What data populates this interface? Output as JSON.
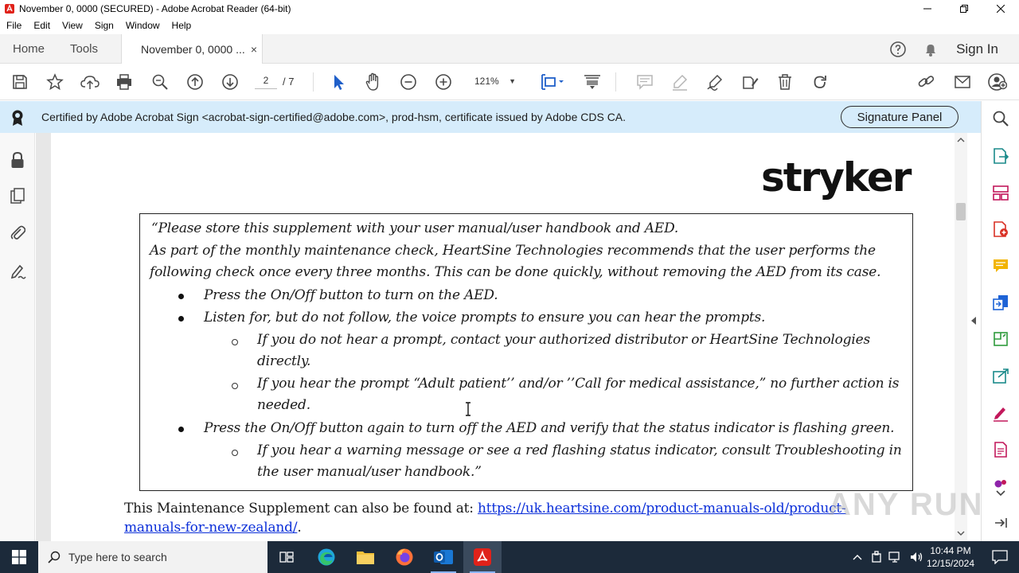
{
  "window": {
    "title": "November 0, 0000 (SECURED) - Adobe Acrobat Reader (64-bit)"
  },
  "menu": [
    "File",
    "Edit",
    "View",
    "Sign",
    "Window",
    "Help"
  ],
  "tabs": {
    "home": "Home",
    "tools": "Tools",
    "document": "November 0, 0000 ...",
    "close": "×",
    "signin": "Sign In"
  },
  "toolbar": {
    "page_current": "2",
    "page_total": "/ 7",
    "zoom": "121%"
  },
  "cert": {
    "text": "Certified by Adobe Acrobat Sign <acrobat-sign-certified@adobe.com>, prod-hsm, certificate issued by Adobe CDS CA.",
    "button": "Signature Panel"
  },
  "document": {
    "logo": "stryker",
    "note_lines": [
      "“Please store this supplement with your user manual/user handbook and AED.",
      "As part of the monthly maintenance check, HeartSine Technologies recommends that the user performs the",
      "following check once every three months. This can be done quickly, without removing the AED from its case."
    ],
    "bullets": [
      "Press the On/Off button to turn on the AED.",
      "Listen for, but do not follow, the voice prompts to ensure you can hear the prompts.",
      "Press the On/Off button again to turn off the AED and verify that the status indicator is flashing green."
    ],
    "sub_bullets": [
      [
        "If you do not hear a prompt, contact your authorized distributor or HeartSine Technologies",
        "directly."
      ],
      [
        "If you hear the prompt “Adult patient’’ and/or ’’Call for medical assistance,” no further action is",
        "needed."
      ],
      [
        "If you hear a warning message or see a red flashing status indicator, consult Troubleshooting in",
        "the user manual/user handbook.”"
      ]
    ],
    "footer_text": "This Maintenance Supplement can also be found at: ",
    "footer_link_1": "https://uk.heartsine.com/product-manuals-old/product-",
    "footer_link_2": "manuals-for-new-zealand/",
    "footer_end": "."
  },
  "watermark": "ANY RUN",
  "taskbar": {
    "search_placeholder": "Type here to search",
    "time": "10:44 PM",
    "date": "12/15/2024"
  },
  "colors": {
    "cert_banner": "#d6ecfb",
    "link": "#0b2fd9",
    "taskbar": "#1c2a3a",
    "acrobat_red": "#e0221a"
  }
}
